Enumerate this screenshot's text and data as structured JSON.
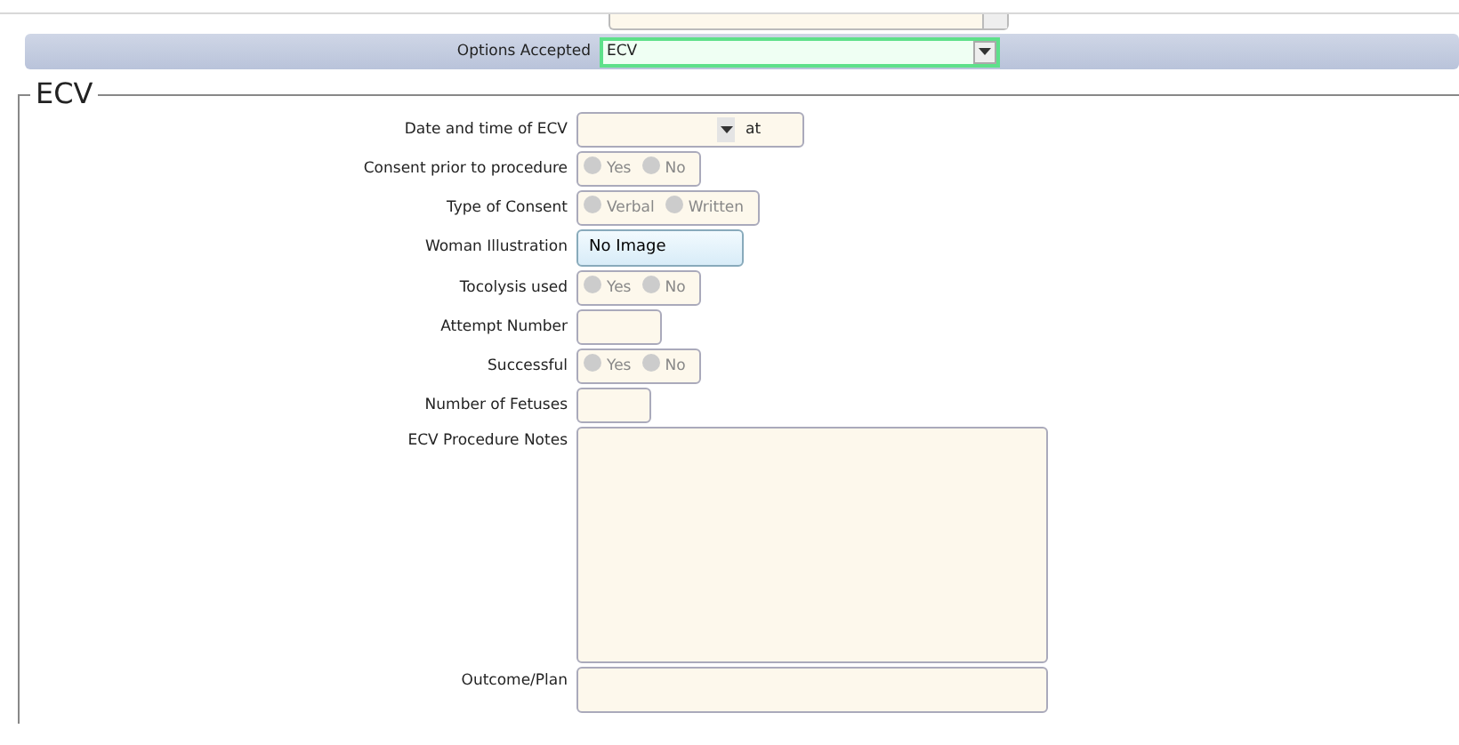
{
  "top_field": {
    "kind": "text"
  },
  "options_accepted": {
    "label": "Options Accepted",
    "value": "ECV"
  },
  "section": {
    "title": "ECV",
    "rows": [
      {
        "kind": "date",
        "label": "Date and time of ECV",
        "suffix": "at"
      },
      {
        "kind": "radio",
        "label": "Consent prior to procedure",
        "options": [
          {
            "label": "Yes",
            "selected": false
          },
          {
            "label": "No",
            "selected": false
          }
        ]
      },
      {
        "kind": "radio",
        "label": "Type of Consent",
        "options": [
          {
            "label": "Verbal",
            "selected": false
          },
          {
            "label": "Written",
            "selected": false
          }
        ]
      },
      {
        "kind": "button",
        "label": "Woman Illustration",
        "value": "No Image"
      },
      {
        "kind": "radio",
        "label": "Tocolysis used",
        "options": [
          {
            "label": "Yes",
            "selected": false
          },
          {
            "label": "No",
            "selected": false
          }
        ]
      },
      {
        "kind": "text",
        "label": "Attempt Number"
      },
      {
        "kind": "radio",
        "label": "Successful",
        "options": [
          {
            "label": "Yes",
            "selected": false
          },
          {
            "label": "No",
            "selected": false
          }
        ]
      },
      {
        "kind": "text",
        "label": "Number of Fetuses"
      },
      {
        "kind": "textarea",
        "label": "ECV Procedure Notes"
      },
      {
        "kind": "textarea",
        "label": "Outcome/Plan"
      }
    ]
  }
}
